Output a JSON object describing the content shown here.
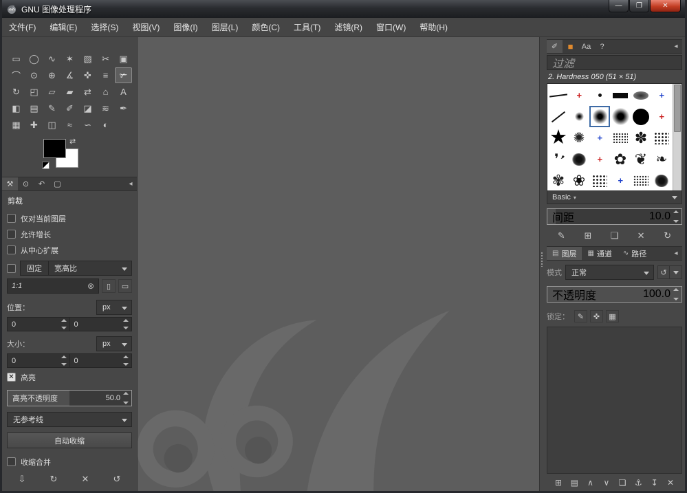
{
  "window": {
    "title": "GNU 图像处理程序",
    "controls": {
      "minimize": "—",
      "maximize": "❐",
      "close": "✕"
    }
  },
  "icons": {
    "corner": "◂",
    "clear": "⊗",
    "portrait": "▯",
    "landscape": "▭",
    "swap": "⇄",
    "mode_reset": "↺",
    "basic_arrow": "▾"
  },
  "menubar": {
    "items": [
      {
        "label": "文件(F)"
      },
      {
        "label": "编辑(E)"
      },
      {
        "label": "选择(S)"
      },
      {
        "label": "视图(V)"
      },
      {
        "label": "图像(I)"
      },
      {
        "label": "图层(L)"
      },
      {
        "label": "颜色(C)"
      },
      {
        "label": "工具(T)"
      },
      {
        "label": "滤镜(R)"
      },
      {
        "label": "窗口(W)"
      },
      {
        "label": "帮助(H)"
      }
    ]
  },
  "toolbox": {
    "tools": [
      {
        "name": "rectangle-select-tool",
        "glyph": "▭"
      },
      {
        "name": "ellipse-select-tool",
        "glyph": "◯"
      },
      {
        "name": "free-select-tool",
        "glyph": "∿"
      },
      {
        "name": "fuzzy-select-tool",
        "glyph": "✶"
      },
      {
        "name": "select-by-color-tool",
        "glyph": "▧"
      },
      {
        "name": "scissors-select-tool",
        "glyph": "✂"
      },
      {
        "name": "foreground-select-tool",
        "glyph": "▣"
      },
      {
        "name": "paths-tool",
        "glyph": "⌒"
      },
      {
        "name": "color-picker-tool",
        "glyph": "⊙"
      },
      {
        "name": "zoom-tool",
        "glyph": "⊕"
      },
      {
        "name": "measure-tool",
        "glyph": "∡"
      },
      {
        "name": "move-tool",
        "glyph": "✜"
      },
      {
        "name": "align-tool",
        "glyph": "≡"
      },
      {
        "name": "crop-tool",
        "glyph": "✃",
        "active": true
      },
      {
        "name": "rotate-tool",
        "glyph": "↻"
      },
      {
        "name": "scale-tool",
        "glyph": "◰"
      },
      {
        "name": "shear-tool",
        "glyph": "▱"
      },
      {
        "name": "perspective-tool",
        "glyph": "▰"
      },
      {
        "name": "flip-tool",
        "glyph": "⇄"
      },
      {
        "name": "cage-transform-tool",
        "glyph": "⌂"
      },
      {
        "name": "text-tool",
        "glyph": "A"
      },
      {
        "name": "bucket-fill-tool",
        "glyph": "◧"
      },
      {
        "name": "blend-tool",
        "glyph": "▤"
      },
      {
        "name": "pencil-tool",
        "glyph": "✎"
      },
      {
        "name": "paintbrush-tool",
        "glyph": "✐"
      },
      {
        "name": "eraser-tool",
        "glyph": "◪"
      },
      {
        "name": "airbrush-tool",
        "glyph": "≋"
      },
      {
        "name": "ink-tool",
        "glyph": "✒"
      },
      {
        "name": "clone-tool",
        "glyph": "▦"
      },
      {
        "name": "heal-tool",
        "glyph": "✚"
      },
      {
        "name": "perspective-clone-tool",
        "glyph": "◫"
      },
      {
        "name": "blur-sharpen-tool",
        "glyph": "≈"
      },
      {
        "name": "smudge-tool",
        "glyph": "∽"
      },
      {
        "name": "dodge-burn-tool",
        "glyph": "◐"
      }
    ]
  },
  "tool_options": {
    "tabs": [
      {
        "name": "tool-options-tab",
        "glyph": "⚒",
        "active": true
      },
      {
        "name": "device-status-tab",
        "glyph": "⊙"
      },
      {
        "name": "undo-history-tab",
        "glyph": "↶"
      },
      {
        "name": "pointer-tab",
        "glyph": "▢"
      }
    ],
    "title": "剪裁",
    "checkboxes": [
      {
        "label": "仅对当前图层",
        "checked": false
      },
      {
        "label": "允许增长",
        "checked": false
      },
      {
        "label": "从中心扩展",
        "checked": false
      }
    ],
    "fixed_label": "固定",
    "fixed_value": "宽高比",
    "ratio_value": "1:1",
    "position_label": "位置：",
    "position_unit": "px",
    "position_x": "0",
    "position_y": "0",
    "size_label": "大小：",
    "size_unit": "px",
    "size_x": "0",
    "size_y": "0",
    "highlight": {
      "label": "高亮",
      "checked": true
    },
    "highlight_opacity": {
      "label": "高亮不透明度",
      "value": "50.0",
      "fill_style": "width:50%"
    },
    "guides_value": "无参考线",
    "autoshrink_label": "自动收缩",
    "shrink_merged": {
      "label": "收缩合并",
      "checked": false
    },
    "footer": [
      {
        "name": "save-options-button",
        "glyph": "⇩"
      },
      {
        "name": "restore-options-button",
        "glyph": "↻"
      },
      {
        "name": "delete-options-button",
        "glyph": "✕"
      },
      {
        "name": "reset-options-button",
        "glyph": "↺"
      }
    ]
  },
  "brushes": {
    "tabs": [
      {
        "name": "brushes-tab",
        "glyph": "✐",
        "active": true
      },
      {
        "name": "patterns-tab",
        "glyph": "■",
        "type": "orange"
      },
      {
        "name": "fonts-tab",
        "glyph": "Aa"
      },
      {
        "name": "document-history-tab",
        "glyph": "?"
      }
    ],
    "filter_placeholder": "过滤",
    "current": "2. Hardness 050 (51 × 51)",
    "grid": [
      {
        "type": "line"
      },
      {
        "type": "plusr"
      },
      {
        "type": "dot"
      },
      {
        "type": "bar"
      },
      {
        "type": "oval"
      },
      {
        "type": "plusb"
      },
      {
        "type": "diag"
      },
      {
        "type": "fuzzydot"
      },
      {
        "type": "sel"
      },
      {
        "type": "fuzzy"
      },
      {
        "type": "circle"
      },
      {
        "type": "plusr"
      },
      {
        "type": "star"
      },
      {
        "type": "sparkle"
      },
      {
        "type": "plusb"
      },
      {
        "type": "chalk"
      },
      {
        "type": "splat"
      },
      {
        "type": "tex"
      },
      {
        "type": "pepper"
      },
      {
        "type": "blob"
      },
      {
        "type": "plusr"
      },
      {
        "type": "floral"
      },
      {
        "type": "vine"
      },
      {
        "type": "leaf"
      },
      {
        "type": "lace"
      },
      {
        "type": "berry"
      },
      {
        "type": "tex"
      },
      {
        "type": "plusb"
      },
      {
        "type": "chalk"
      },
      {
        "type": "blob"
      }
    ],
    "group_label": "Basic",
    "spacing": {
      "label": "间距",
      "value": "10.0",
      "fill_style": "width:6%"
    },
    "footer": [
      {
        "name": "edit-brush-button",
        "glyph": "✎"
      },
      {
        "name": "new-brush-button",
        "glyph": "⊞"
      },
      {
        "name": "duplicate-brush-button",
        "glyph": "❏"
      },
      {
        "name": "delete-brush-button",
        "glyph": "✕"
      },
      {
        "name": "refresh-brushes-button",
        "glyph": "↻"
      }
    ]
  },
  "layers": {
    "tabs": [
      {
        "name": "layers-tab",
        "glyph": "▤",
        "label": "图层",
        "active": true
      },
      {
        "name": "channels-tab",
        "glyph": "▦",
        "label": "通道"
      },
      {
        "name": "paths-tab",
        "glyph": "∿",
        "label": "路径"
      }
    ],
    "mode_label": "模式",
    "mode_value": "正常",
    "opacity": {
      "label": "不透明度",
      "value": "100.0",
      "fill_style": "width:100%"
    },
    "lock_label": "锁定：",
    "lock_buttons": [
      {
        "name": "lock-pixels-button",
        "glyph": "✎"
      },
      {
        "name": "lock-position-button",
        "glyph": "✜"
      },
      {
        "name": "lock-alpha-button",
        "glyph": "▦"
      }
    ],
    "footer": [
      {
        "name": "new-layer-button",
        "glyph": "⊞"
      },
      {
        "name": "new-group-button",
        "glyph": "▤"
      },
      {
        "name": "raise-layer-button",
        "glyph": "∧"
      },
      {
        "name": "lower-layer-button",
        "glyph": "∨"
      },
      {
        "name": "duplicate-layer-button",
        "glyph": "❏"
      },
      {
        "name": "anchor-layer-button",
        "glyph": "⚓"
      },
      {
        "name": "merge-down-button",
        "glyph": "↧"
      },
      {
        "name": "delete-layer-button",
        "glyph": "✕"
      }
    ]
  }
}
